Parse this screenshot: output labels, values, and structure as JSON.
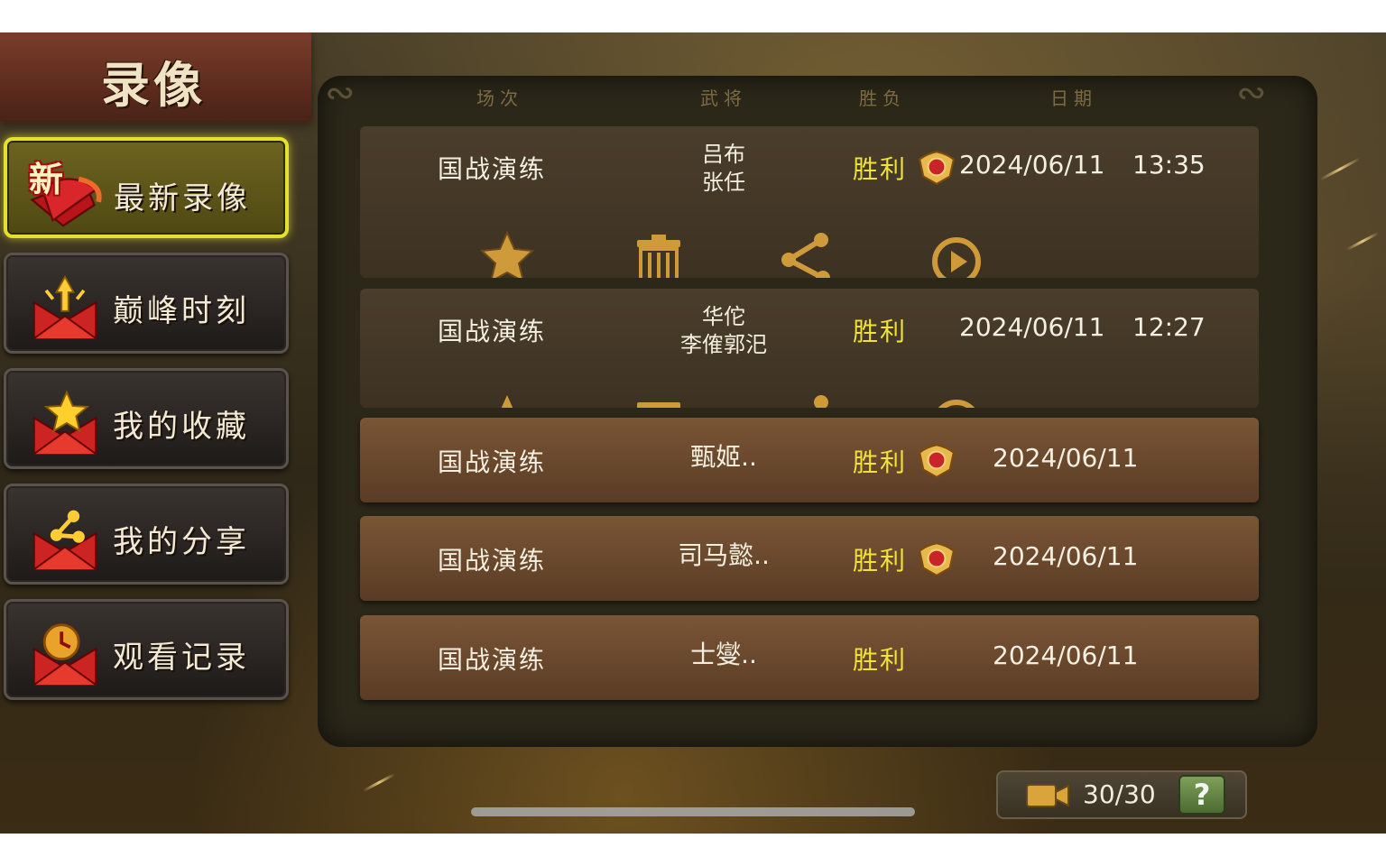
{
  "title": "录像",
  "sidebar": {
    "items": [
      {
        "label": "最新录像",
        "icon": "new-recording-icon",
        "badge": "新",
        "active": true
      },
      {
        "label": "巅峰时刻",
        "icon": "peak-moment-envelope-icon",
        "active": false
      },
      {
        "label": "我的收藏",
        "icon": "favorite-star-envelope-icon",
        "active": false
      },
      {
        "label": "我的分享",
        "icon": "share-envelope-icon",
        "active": false
      },
      {
        "label": "观看记录",
        "icon": "history-clock-envelope-icon",
        "active": false
      }
    ]
  },
  "table": {
    "headers": [
      "场次",
      "武将",
      "胜负",
      "日期"
    ],
    "rows": [
      {
        "mode": "国战演练",
        "generals": [
          "吕布",
          "张任"
        ],
        "result": "胜利",
        "mvp_badge": true,
        "date": "2024/06/11",
        "time": "13:35",
        "expanded": true
      },
      {
        "mode": "国战演练",
        "generals": [
          "华佗",
          "李傕郭汜"
        ],
        "result": "胜利",
        "mvp_badge": false,
        "date": "2024/06/11",
        "time": "12:27",
        "expanded": true
      },
      {
        "mode": "国战演练",
        "generals": [
          "甄姬.."
        ],
        "result": "胜利",
        "mvp_badge": true,
        "date": "2024/06/11",
        "time": "",
        "expanded": false
      },
      {
        "mode": "国战演练",
        "generals": [
          "司马懿.."
        ],
        "result": "胜利",
        "mvp_badge": true,
        "date": "2024/06/11",
        "time": "",
        "expanded": false
      },
      {
        "mode": "国战演练",
        "generals": [
          "士燮.."
        ],
        "result": "胜利",
        "mvp_badge": false,
        "date": "2024/06/11",
        "time": "",
        "expanded": false
      }
    ],
    "row_actions": [
      "star-icon",
      "trash-icon",
      "share-icon",
      "replay-icon"
    ]
  },
  "footer": {
    "recording_count": "30/30",
    "help_label": "?"
  },
  "colors": {
    "result": "#f0e23a",
    "active_border": "#e5e02a",
    "title_banner": "#6a3322"
  }
}
